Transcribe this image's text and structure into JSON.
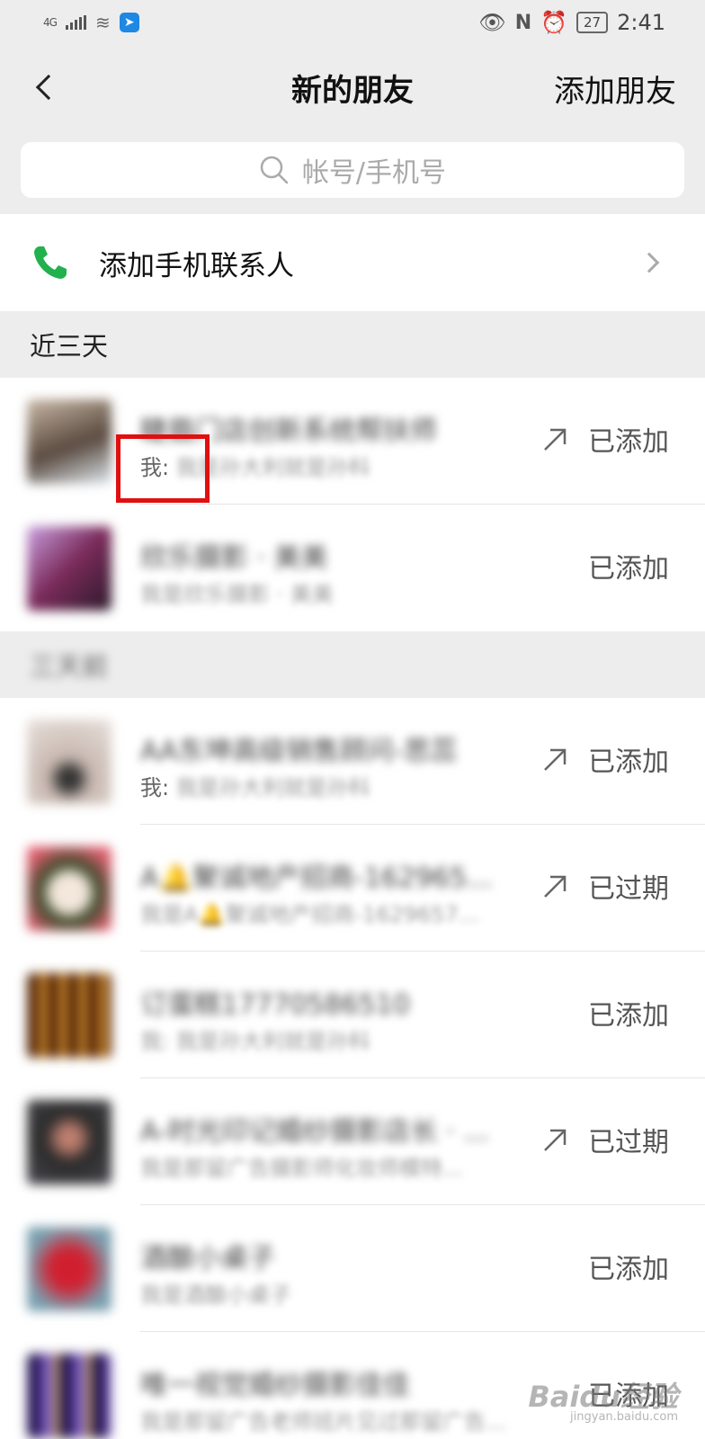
{
  "status_bar": {
    "network": "4G",
    "battery": "27",
    "time": "2:41"
  },
  "navbar": {
    "title": "新的朋友",
    "action": "添加朋友"
  },
  "search": {
    "placeholder": "帐号/手机号"
  },
  "add_phone_contacts": {
    "label": "添加手机联系人"
  },
  "sections": [
    {
      "header": "近三天",
      "items": [
        {
          "name": "睫眉门店创新系统帮扶师",
          "message_prefix": "我:",
          "message": "我是孙大利就是孙科",
          "status": "已添加",
          "arrow": true,
          "avatar_color": "#8a7a6a"
        },
        {
          "name": "欣乐摄影 · 美美",
          "message_prefix": "",
          "message": "我是欣乐摄影 · 美美",
          "status": "已添加",
          "arrow": false,
          "avatar_color": "#7a3a6a"
        }
      ]
    },
    {
      "header": "三天前",
      "items": [
        {
          "name": "AA东坤高级销售顾问-思蕊",
          "message_prefix": "我:",
          "message": "我是孙大利就是孙科",
          "status": "已添加",
          "arrow": true,
          "avatar_color": "#b8a8a0"
        },
        {
          "name": "A🔔聚诚地产招商-162965...",
          "message_prefix": "",
          "message": "我是A🔔聚诚地产招商-1629657...",
          "status": "已过期",
          "arrow": true,
          "avatar_color": "#4a5a3a"
        },
        {
          "name": "订蛋糕17770586510",
          "message_prefix": "",
          "message": "我: 我是孙大利就是孙科",
          "status": "已添加",
          "arrow": false,
          "avatar_color": "#6a3a1a"
        },
        {
          "name": "A-时光印记婚纱摄影店长 · ...",
          "message_prefix": "",
          "message": "我是那留广告摄影师化妆师模特...",
          "status": "已过期",
          "arrow": true,
          "avatar_color": "#3a3a3a"
        },
        {
          "name": "酒酿小桌子",
          "message_prefix": "",
          "message": "我是酒酿小桌子",
          "status": "已添加",
          "arrow": false,
          "avatar_color": "#c03040"
        },
        {
          "name": "唯一视觉婚纱摄影佳佳",
          "message_prefix": "",
          "message": "我是那留广告老师班片见过那留广告...",
          "status": "已添加",
          "arrow": false,
          "avatar_color": "#5a4a8a"
        }
      ]
    }
  ],
  "watermark": {
    "brand": "Baidu经验",
    "url": "jingyan.baidu.com"
  }
}
